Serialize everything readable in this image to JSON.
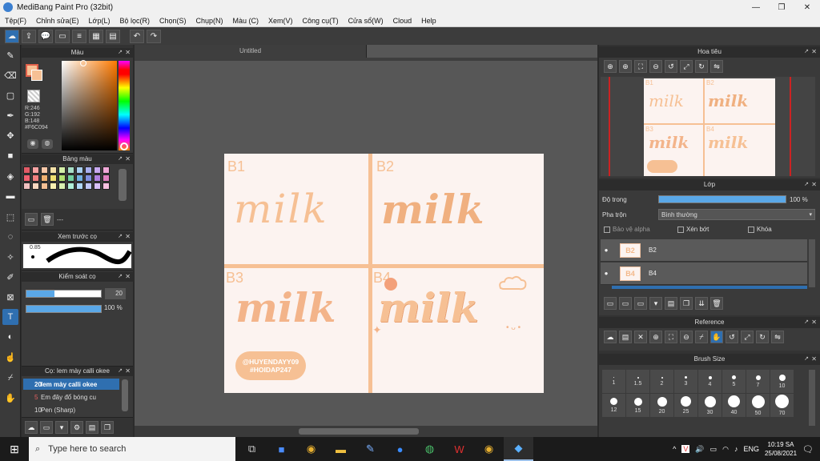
{
  "app": {
    "title": "MediBang Paint Pro (32bit)",
    "accent": "#2f6fb0"
  },
  "window_buttons": [
    "—",
    "❐",
    "✕"
  ],
  "menu": [
    "Tệp(F)",
    "Chỉnh sửa(E)",
    "Lớp(L)",
    "Bộ lọc(R)",
    "Chọn(S)",
    "Chụp(N)",
    "Màu (C)",
    "Xem(V)",
    "Công cụ(T)",
    "Cửa sổ(W)",
    "Cloud",
    "Help"
  ],
  "toolbar_icons": [
    "cloud-icon",
    "share-icon",
    "comment-icon",
    "page-icon",
    "list-icon",
    "grid-icon",
    "undo-icon",
    "redo-icon"
  ],
  "left_tools": [
    "brush-icon",
    "eraser-icon",
    "rectangle-icon",
    "pen-icon",
    "move-icon",
    "fill-rect-icon",
    "bucket-icon",
    "gradient-icon",
    "select-icon",
    "lasso-icon",
    "magic-wand-icon",
    "selection-pen-icon",
    "selection-eraser-icon",
    "text-icon",
    "blur-icon",
    "smudge-icon",
    "eyedropper-icon",
    "hand-icon"
  ],
  "color_panel": {
    "title": "Màu",
    "r": "R:246",
    "g": "G:192",
    "b": "B:148",
    "hex": "#F6C094",
    "current_color": "#f6c094"
  },
  "palette_panel": {
    "title": "Bảng màu",
    "name": "---"
  },
  "brush_preview": {
    "title": "Xem trước cọ",
    "size": "0.85"
  },
  "brush_control": {
    "title": "Kiểm soát cọ",
    "size_value": "20",
    "opacity_value": "100 %"
  },
  "brush_list": {
    "title": "Cọ: Iem mày calli okee",
    "items": [
      {
        "size": "20",
        "name": "Iem mày calli okee",
        "selected": true
      },
      {
        "size": "5",
        "name": "Em đây đổ bóng cu",
        "selected": false
      },
      {
        "size": "10",
        "name": "Pen (Sharp)",
        "selected": false
      }
    ]
  },
  "document": {
    "tab": "Untitled",
    "panels": [
      {
        "label": "B1",
        "text": "milk"
      },
      {
        "label": "B2",
        "text": "milk"
      },
      {
        "label": "B3",
        "text": "milk"
      },
      {
        "label": "B4",
        "text": "milk"
      }
    ],
    "stamp_line1": "@HUYENDAYY09",
    "stamp_line2": "#HOIDAP247"
  },
  "navigator": {
    "title": "Hoa tiêu"
  },
  "layers_panel": {
    "title": "Lớp",
    "opacity_label": "Độ trong",
    "opacity_value": "100 %",
    "opacity_fraction": 1.0,
    "blend_label": "Pha trộn",
    "blend_value": "Bình thường",
    "protect_alpha": "Bảo vệ alpha",
    "clipping": "Xén bớt",
    "lock": "Khóa",
    "layers": [
      {
        "name": "B2",
        "thumb": "B2"
      },
      {
        "name": "B4",
        "thumb": "B4"
      }
    ]
  },
  "reference_panel": {
    "title": "Reference"
  },
  "brush_size_panel": {
    "title": "Brush Size",
    "sizes": [
      "1",
      "1.5",
      "2",
      "3",
      "4",
      "5",
      "7",
      "10",
      "12",
      "15",
      "20",
      "25",
      "30",
      "40",
      "50",
      "70"
    ]
  },
  "taskbar": {
    "search_placeholder": "Type here to search",
    "language": "ENG",
    "time": "10:19 SA",
    "date": "25/08/2021"
  }
}
